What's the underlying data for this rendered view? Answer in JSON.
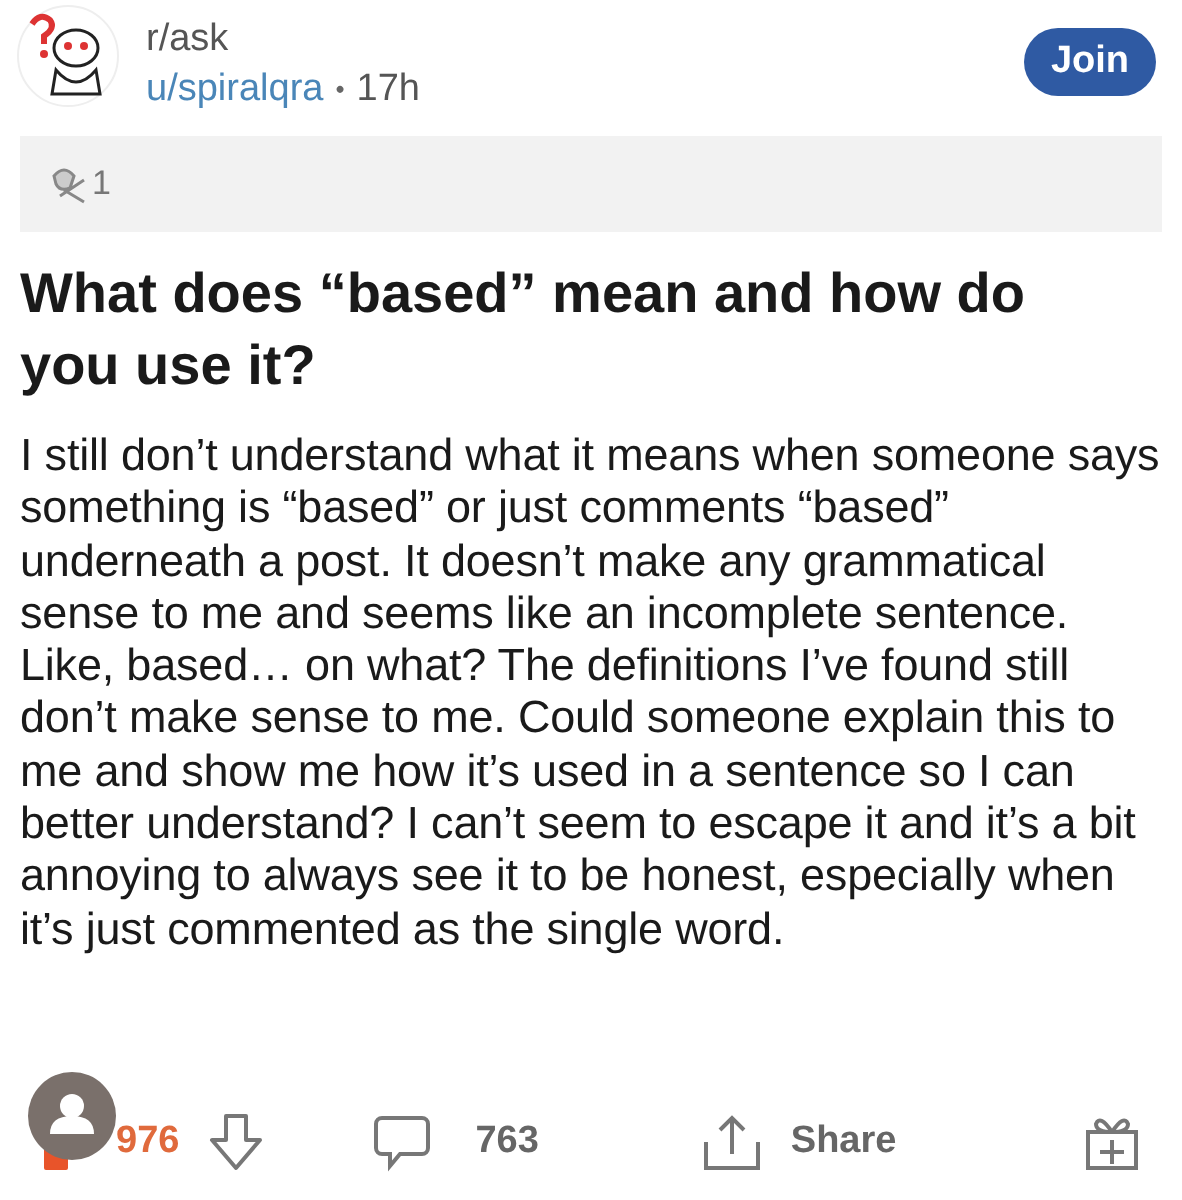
{
  "header": {
    "subreddit": "r/ask",
    "author": "u/spiralqra",
    "separator": "•",
    "time": "17h",
    "join_button": "Join"
  },
  "awards": {
    "count": "1"
  },
  "post": {
    "title": "What does “based” mean and how do you use it?",
    "body": "I still don’t understand what it means when someone says something is “based” or just comments “based” underneath a post. It doesn’t make any grammatical sense to me and seems like an incomplete sentence. Like, based… on what? The definitions I’ve found still don’t make sense to me. Could someone explain this to me and show me how it’s used in a sentence so I can better understand? I can’t seem to escape it and it’s a bit annoying to always see it to be honest, especially when it’s just commented as the single word."
  },
  "actions": {
    "upvoted": true,
    "score": "976",
    "comments": "763",
    "share": "Share"
  }
}
